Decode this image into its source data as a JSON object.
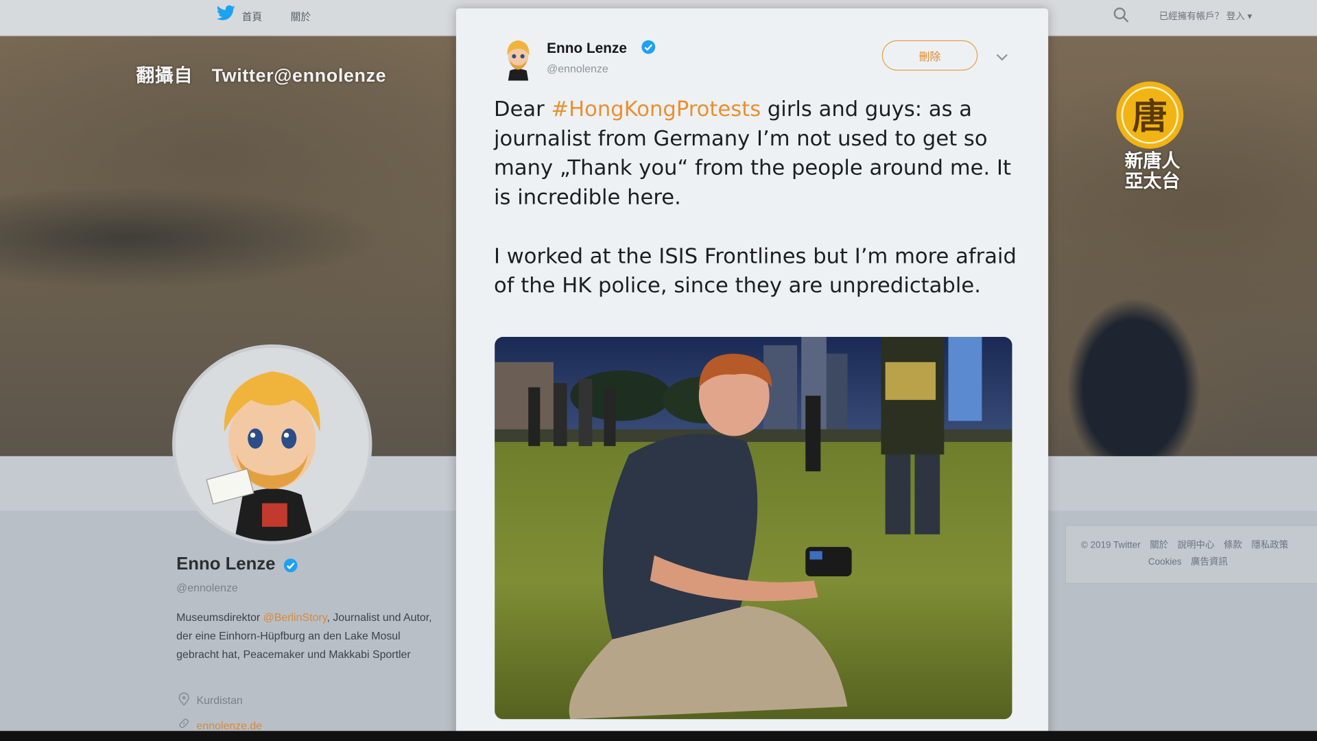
{
  "topnav": {
    "home_label": "首頁",
    "about_label": "關於",
    "account_label": "已經擁有帳戶？ 登入 ▾"
  },
  "overlay": {
    "credit": "翻攝自　Twitter@ennolenze",
    "station_logo_line1": "新唐人",
    "station_logo_line2": "亞太台"
  },
  "profile": {
    "name": "Enno Lenze",
    "handle": "@ennolenze",
    "bio_before": "Museumsdirektor ",
    "bio_link": "@BerlinStory",
    "bio_after": ", Journalist und Autor, der eine Einhorn-Hüpfburg an den Lake Mosul gebracht hat, Peacemaker und Makkabi Sportler",
    "location": "Kurdistan",
    "url": "ennolenze.de"
  },
  "footer": {
    "line1": "© 2019 Twitter　關於　說明中心　條款　隱私政策",
    "line2": "Cookies　廣告資訊"
  },
  "tweet": {
    "author_name": "Enno Lenze",
    "author_handle": "@ennolenze",
    "delete_label": "刪除",
    "text_p1_before": "Dear ",
    "hashtag": "#HongKongProtests",
    "text_p1_after": " girls and guys: as a journalist from Germany I’m not used to get so many „Thank you“ from the people around me. It is incredible here.",
    "text_p2": "I worked at the ISIS Frontlines but I’m more afraid of the HK police, since they are unpredictable."
  },
  "colors": {
    "accent": "#e8902f",
    "verified": "#1da1f2",
    "card_bg": "#eef1f4"
  },
  "icons": {
    "bird": "twitter-bird-icon",
    "search": "search-icon",
    "verified": "verified-badge-icon",
    "chevron": "chevron-down-icon",
    "location": "map-pin-icon",
    "link": "link-icon"
  }
}
